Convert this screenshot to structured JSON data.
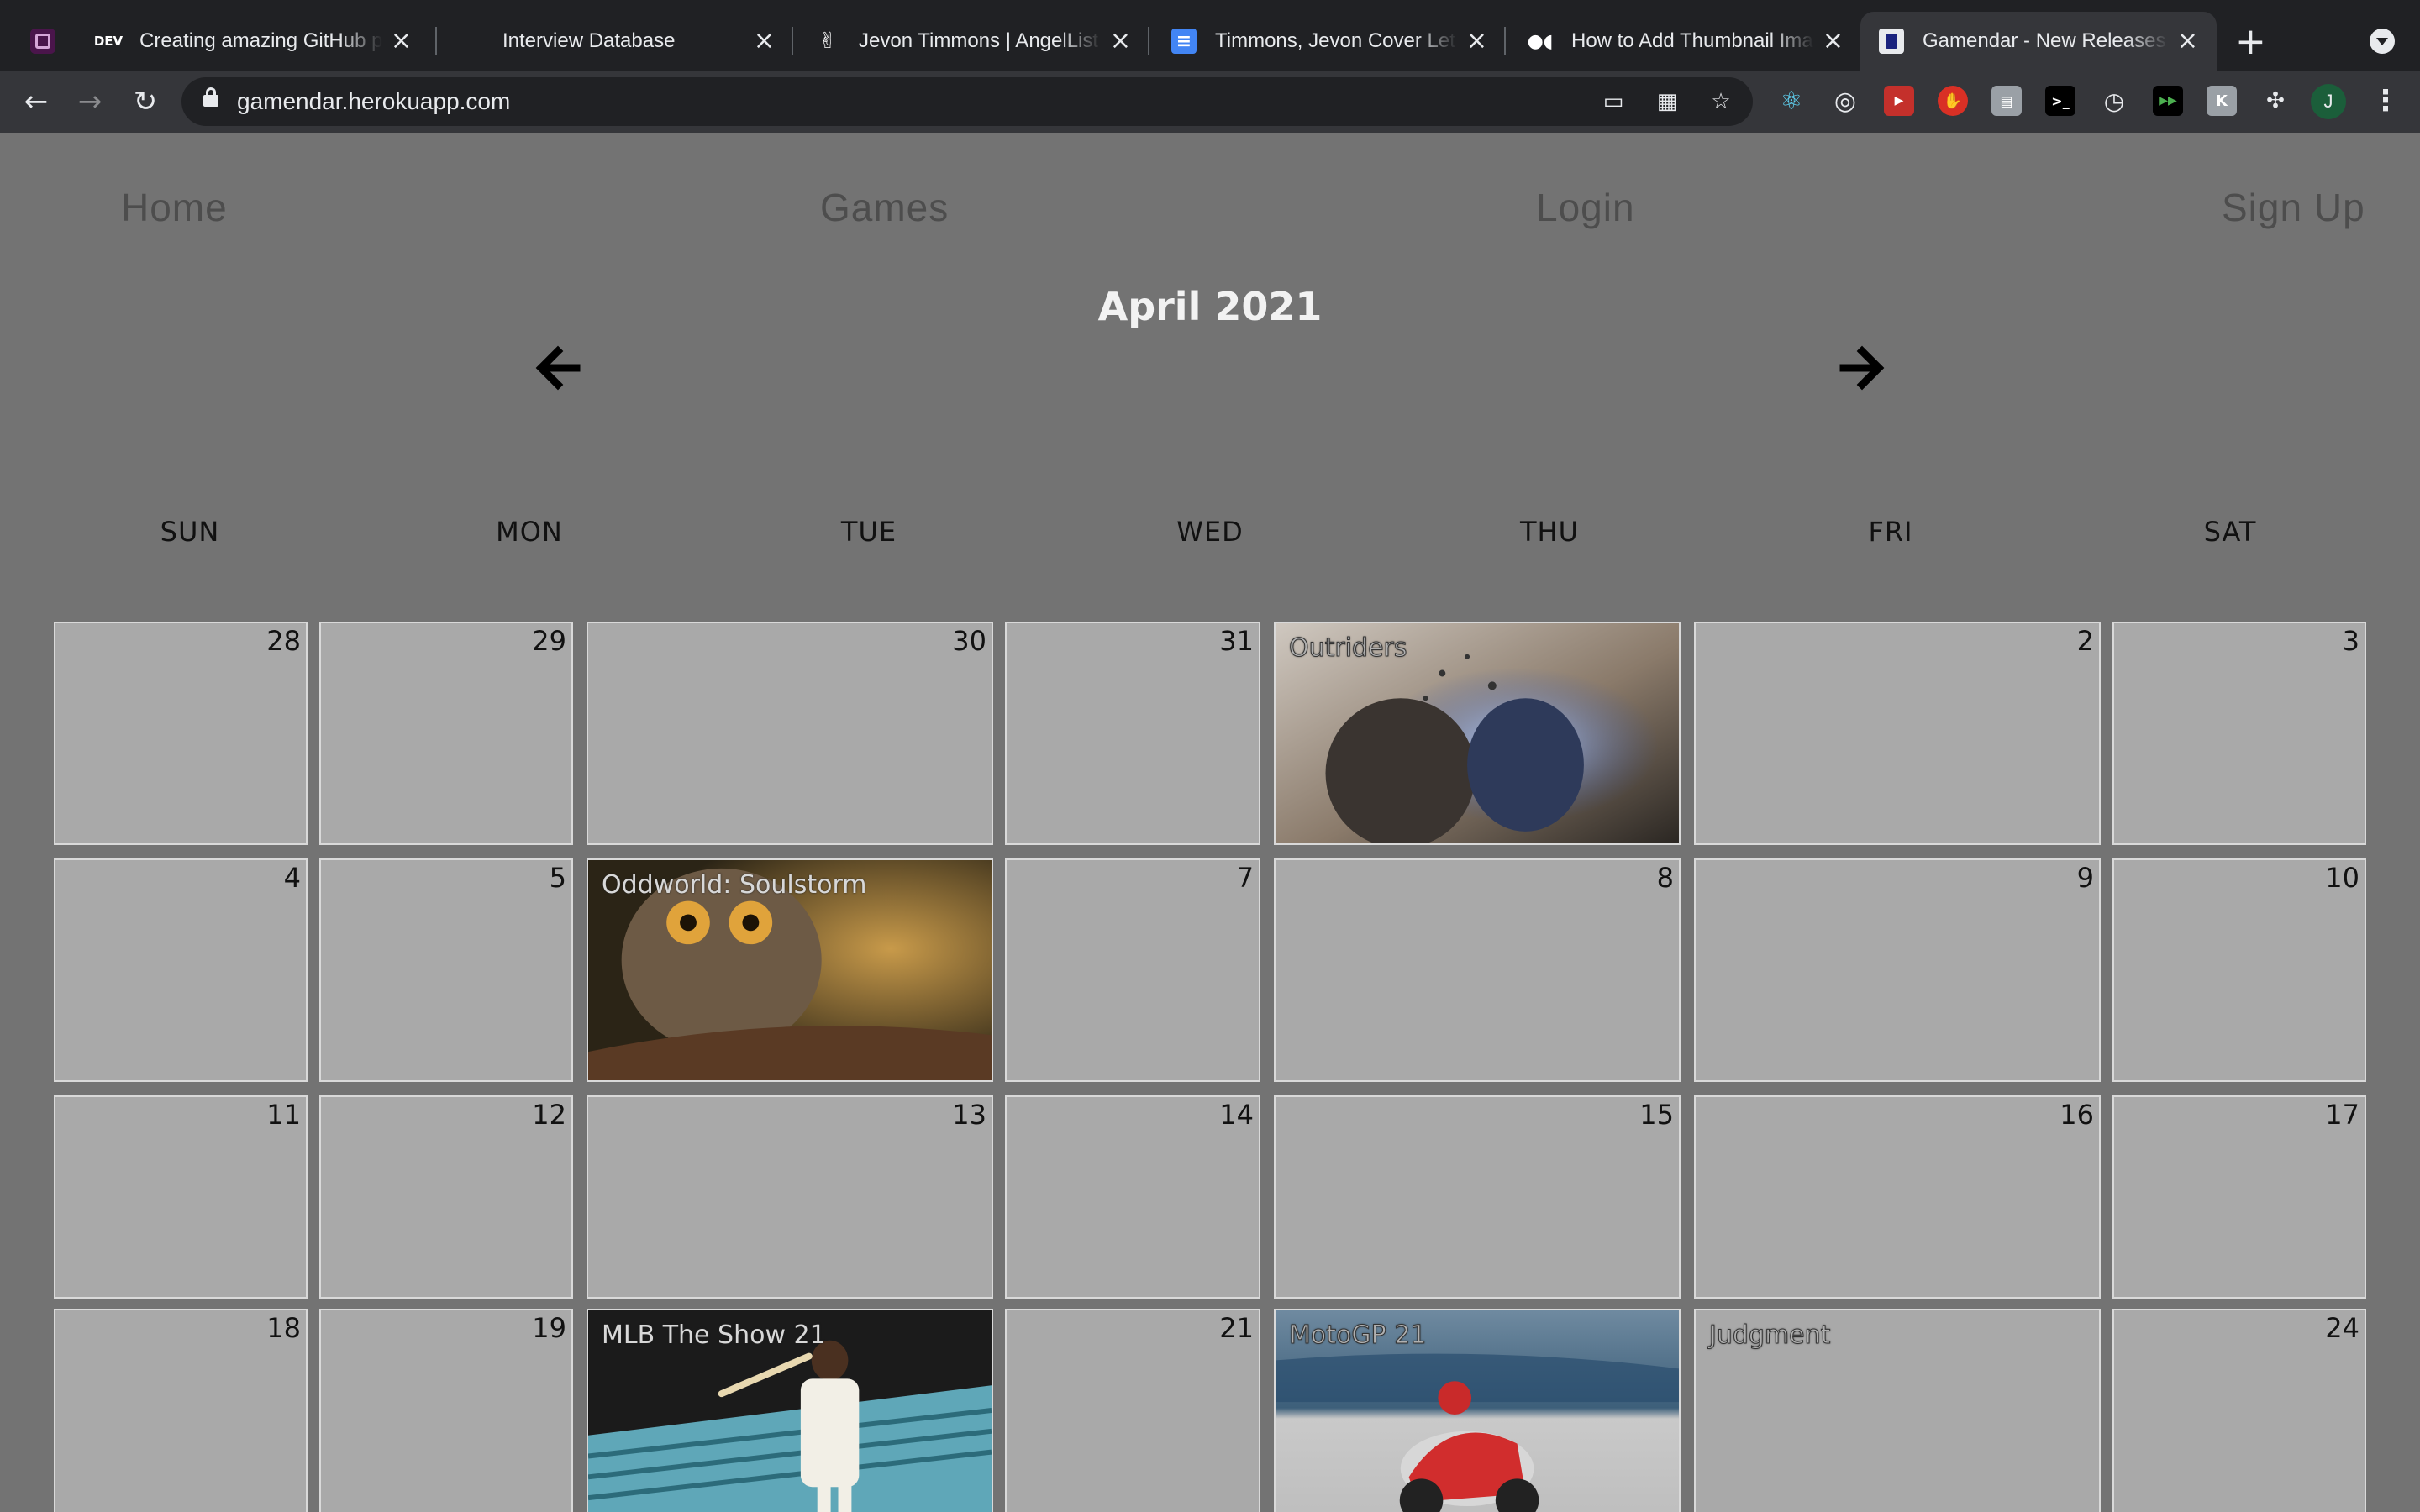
{
  "browser": {
    "tabs": [
      {
        "title": "Creating amazing GitHub p",
        "favicon": "dev-icon",
        "favicon_text": "DEV"
      },
      {
        "title": "Interview Database",
        "favicon": "database-icon"
      },
      {
        "title": "Jevon Timmons | AngelList",
        "favicon": "angellist-icon"
      },
      {
        "title": "Timmons, Jevon Cover Let",
        "favicon": "docs-icon"
      },
      {
        "title": "How to Add Thumbnail Ima",
        "favicon": "medium-icon"
      },
      {
        "title": "Gamendar - New Releases",
        "favicon": "gamendar-icon",
        "active": true
      }
    ],
    "url": "gamendar.herokuapp.com",
    "avatar_initial": "J"
  },
  "nav": {
    "home": "Home",
    "games": "Games",
    "login": "Login",
    "signup": "Sign Up"
  },
  "calendar": {
    "month_title": "April 2021",
    "weekdays": [
      "SUN",
      "MON",
      "TUE",
      "WED",
      "THU",
      "FRI",
      "SAT"
    ],
    "weeks": [
      [
        {
          "day": "28"
        },
        {
          "day": "29"
        },
        {
          "day": "30"
        },
        {
          "day": "31"
        },
        {
          "day": "",
          "game": "Outriders"
        },
        {
          "day": "2"
        },
        {
          "day": "3"
        }
      ],
      [
        {
          "day": "4"
        },
        {
          "day": "5"
        },
        {
          "day": "",
          "game": "Oddworld: Soulstorm"
        },
        {
          "day": "7"
        },
        {
          "day": "8"
        },
        {
          "day": "9"
        },
        {
          "day": "10"
        }
      ],
      [
        {
          "day": "11"
        },
        {
          "day": "12"
        },
        {
          "day": "13"
        },
        {
          "day": "14"
        },
        {
          "day": "15"
        },
        {
          "day": "16"
        },
        {
          "day": "17"
        }
      ],
      [
        {
          "day": "18"
        },
        {
          "day": "19"
        },
        {
          "day": "",
          "game": "MLB The Show 21"
        },
        {
          "day": "21"
        },
        {
          "day": "",
          "game": "MotoGP 21"
        },
        {
          "day": "",
          "game": "Judgment"
        },
        {
          "day": "24"
        }
      ]
    ]
  },
  "colors": {
    "page_bg": "#737373",
    "cell_bg": "#a9a9a9",
    "cell_border": "#d9d9d9",
    "nav_text": "#4d4d4d",
    "title_text": "#f2f2f2"
  }
}
